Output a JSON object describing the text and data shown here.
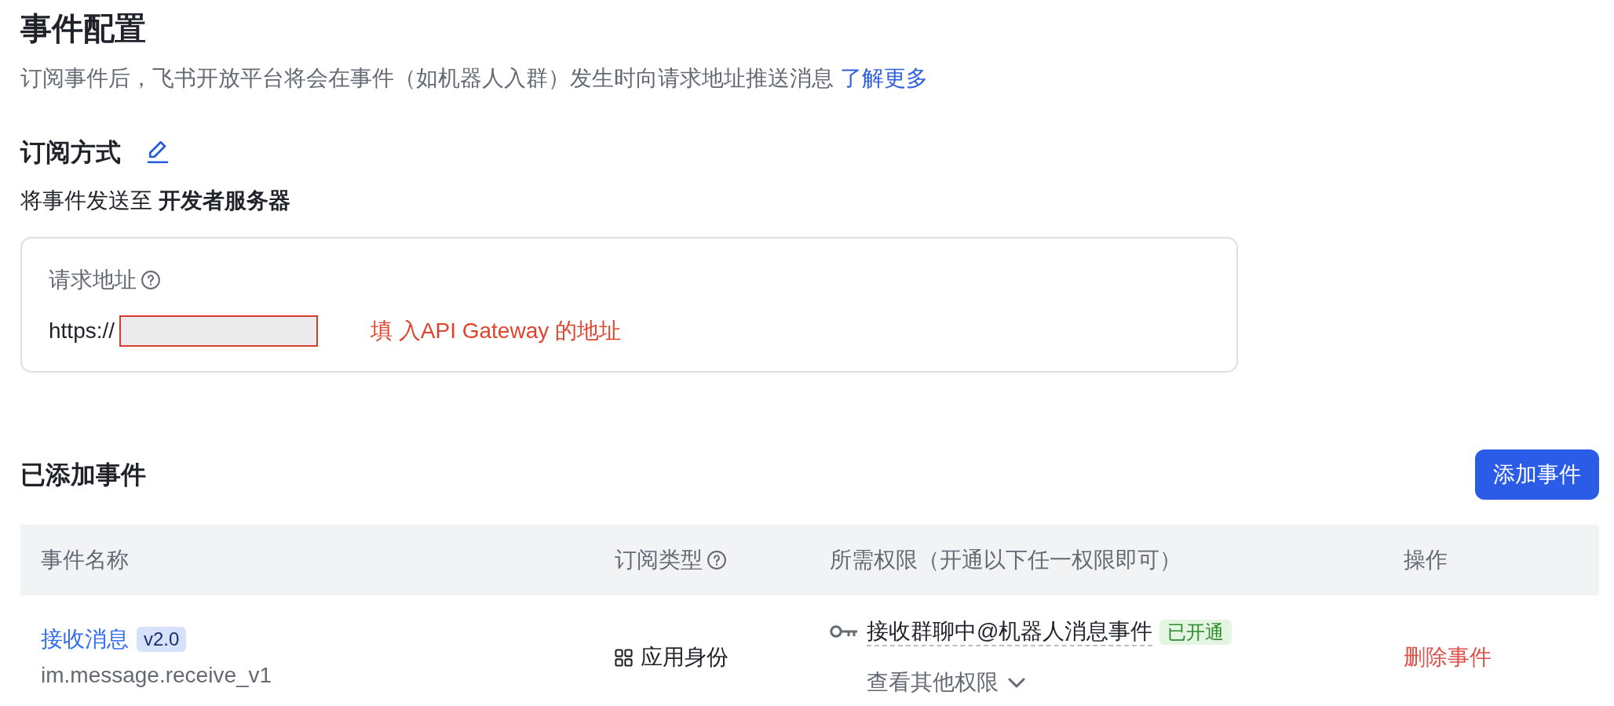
{
  "page": {
    "title": "事件配置",
    "description": "订阅事件后，飞书开放平台将会在事件（如机器人入群）发生时向请求地址推送消息",
    "learn_more_link": "了解更多"
  },
  "subscription": {
    "title": "订阅方式",
    "summary": "将事件发送至 **开发者服务器**"
  },
  "request_url": {
    "label": "请求地址",
    "prefix": "https://",
    "redacted": true,
    "annotation": "填 入API Gateway 的地址"
  },
  "events": {
    "title": "已添加事件",
    "add_button": "添加事件",
    "columns": [
      {
        "label": "事件名称",
        "help": false
      },
      {
        "label": "订阅类型",
        "help": true
      },
      {
        "label": "所需权限（开通以下任一权限即可）",
        "help": false
      },
      {
        "label": "操作",
        "help": false
      }
    ],
    "rows": [
      {
        "name": "接收消息",
        "version": "v2.0",
        "event_key": "im.message.receive_v1",
        "subscription_type": "应用身份",
        "permissions": [
          {
            "name": "接收群聊中@机器人消息事件",
            "status": "已开通"
          }
        ],
        "more_permissions": "查看其他权限",
        "action": "删除事件"
      }
    ]
  }
}
